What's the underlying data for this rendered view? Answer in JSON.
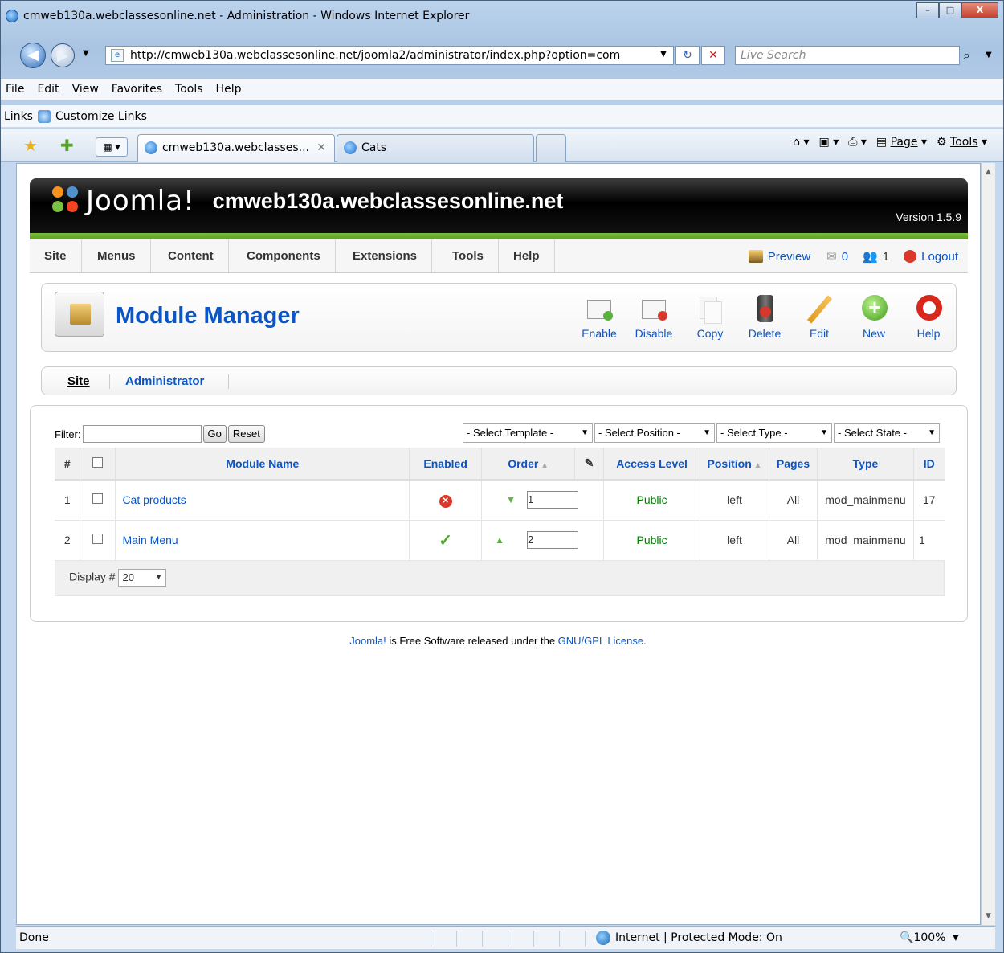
{
  "window": {
    "title": "cmweb130a.webclassesonline.net - Administration - Windows Internet Explorer",
    "minimize": "–",
    "maximize": "□",
    "close": "X"
  },
  "address": {
    "url": "http://cmweb130a.webclassesonline.net/joomla2/administrator/index.php?option=com",
    "search_placeholder": "Live Search"
  },
  "menubar": [
    "File",
    "Edit",
    "View",
    "Favorites",
    "Tools",
    "Help"
  ],
  "links": {
    "label": "Links",
    "customize": "Customize Links"
  },
  "tabs": [
    {
      "label": "cmweb130a.webclasses...",
      "active": true
    },
    {
      "label": "Cats",
      "active": false
    }
  ],
  "commandbar": {
    "page": "Page",
    "tools": "Tools"
  },
  "joomla": {
    "brand": "Joomla!",
    "site_name": "cmweb130a.webclassesonline.net",
    "version": "Version 1.5.9",
    "menu": [
      "Site",
      "Menus",
      "Content",
      "Components",
      "Extensions",
      "Tools",
      "Help"
    ],
    "preview": "Preview",
    "messages_count": "0",
    "users_count": "1",
    "logout": "Logout",
    "page_title": "Module Manager",
    "toolbar": [
      "Enable",
      "Disable",
      "Copy",
      "Delete",
      "Edit",
      "New",
      "Help"
    ],
    "submenu": [
      "Site",
      "Administrator"
    ],
    "filter_label": "Filter:",
    "go": "Go",
    "reset": "Reset",
    "selects": [
      "- Select Template -",
      "- Select Position -",
      "- Select Type -",
      "- Select State -"
    ],
    "columns": [
      "#",
      "Module Name",
      "Enabled",
      "Order",
      "Access Level",
      "Position",
      "Pages",
      "Type",
      "ID"
    ],
    "rows": [
      {
        "num": "1",
        "name": "Cat products",
        "enabled": false,
        "order": "1",
        "access": "Public",
        "position": "left",
        "pages": "All",
        "type": "mod_mainmenu",
        "id": "17"
      },
      {
        "num": "2",
        "name": "Main Menu",
        "enabled": true,
        "order": "2",
        "access": "Public",
        "position": "left",
        "pages": "All",
        "type": "mod_mainmenu",
        "id": "1"
      }
    ],
    "display_label": "Display #",
    "display_value": "20",
    "credit_link1": "Joomla!",
    "credit_mid": " is Free Software released under the ",
    "credit_link2": "GNU/GPL License",
    "credit_end": "."
  },
  "status": {
    "text": "Done",
    "zone": "Internet | Protected Mode: On",
    "zoom": "100%"
  },
  "colors": {
    "link": "#0b55c4",
    "green_bar": "#6aad2e",
    "public": "#008000"
  }
}
